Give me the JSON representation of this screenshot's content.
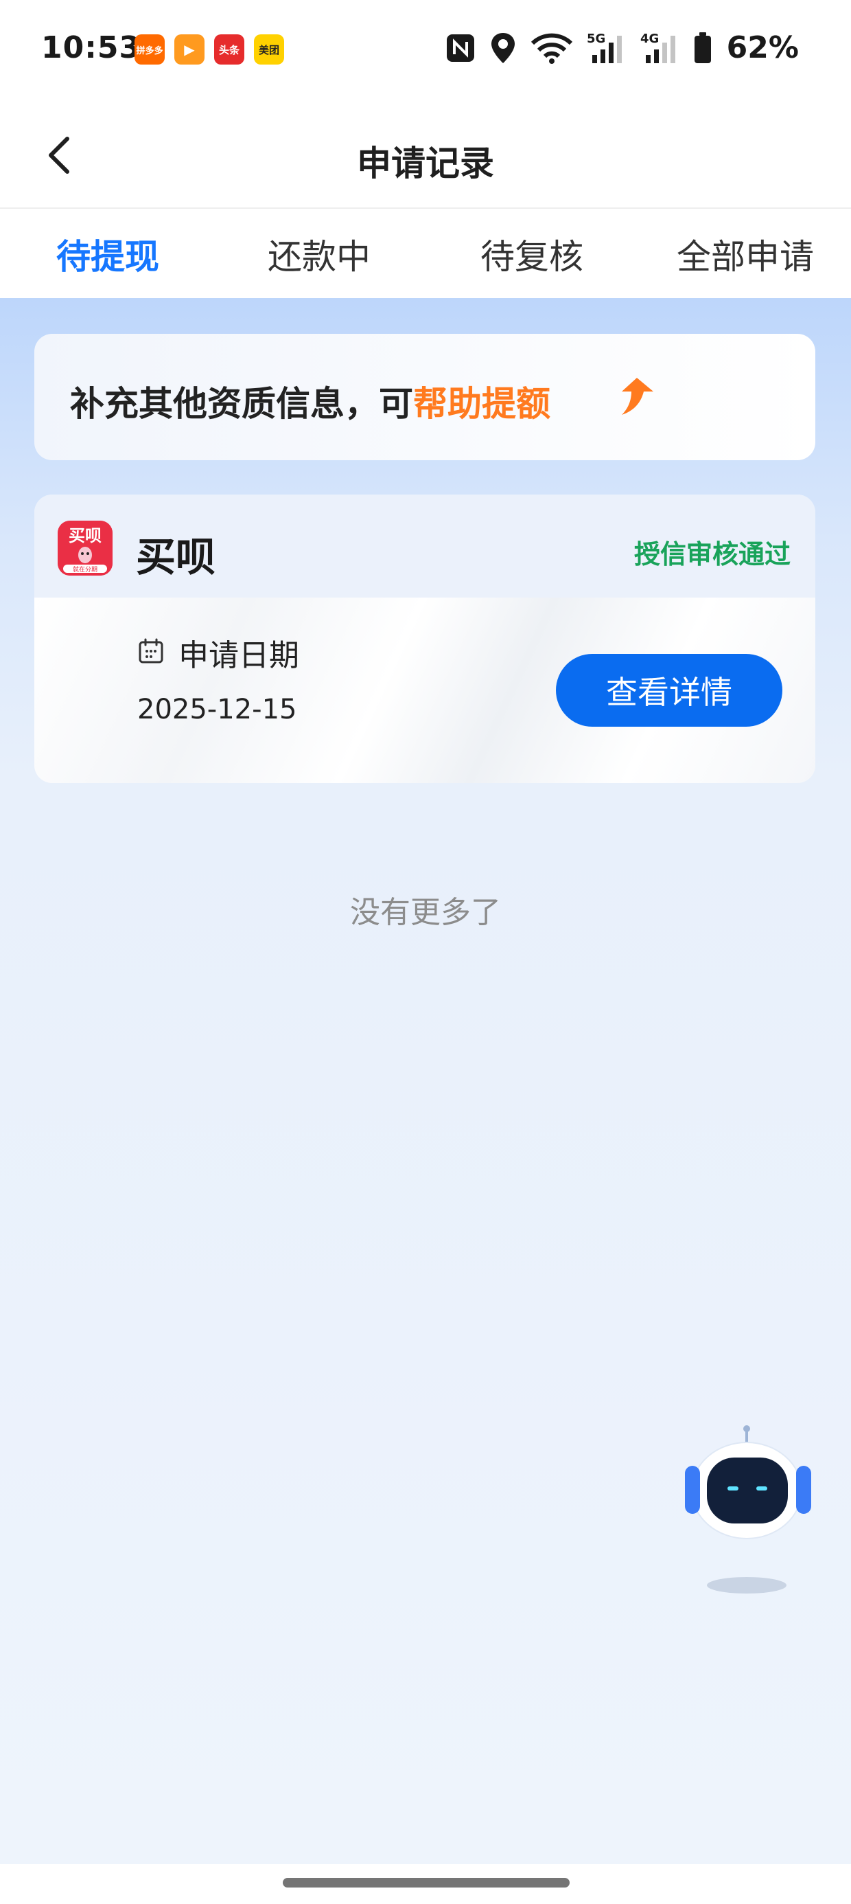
{
  "status_bar": {
    "time": "10:53",
    "app_icons": [
      {
        "name": "pinduoduo-icon",
        "label": "拼多多",
        "color": "#ff6a00"
      },
      {
        "name": "video-app-icon",
        "label": "▶",
        "color": "#ff9a1f"
      },
      {
        "name": "toutiao-icon",
        "label": "头条",
        "color": "#e62c2c"
      },
      {
        "name": "meituan-icon",
        "label": "美团",
        "color": "#ffd100"
      }
    ],
    "battery_percent": "62%",
    "network_1": "5G",
    "network_2": "4G"
  },
  "nav": {
    "title": "申请记录"
  },
  "tabs": [
    {
      "label": "待提现",
      "active": true
    },
    {
      "label": "还款中",
      "active": false
    },
    {
      "label": "待复核",
      "active": false
    },
    {
      "label": "全部申请",
      "active": false
    }
  ],
  "promo": {
    "text_prefix": "补充其他资质信息，可",
    "text_highlight": "帮助提额"
  },
  "card": {
    "logo_text": "买呗",
    "logo_sub": "就在分期",
    "name": "买呗",
    "status": "授信审核通过",
    "date_label": "申请日期",
    "date_value": "2025-12-15",
    "button_label": "查看详情"
  },
  "footer_text": "没有更多了",
  "colors": {
    "accent": "#1677ff",
    "highlight": "#ff7a1f",
    "status_green": "#19a35a",
    "button_blue": "#0a6cf0"
  }
}
